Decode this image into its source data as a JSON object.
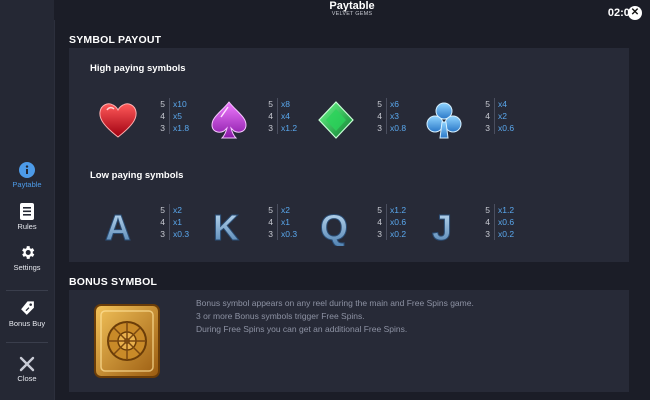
{
  "header": {
    "title": "Paytable",
    "subtitle": "VELVET GEMS",
    "clock": "02:00"
  },
  "sidebar": [
    {
      "label": "Paytable",
      "icon": "info-icon",
      "active": true
    },
    {
      "label": "Rules",
      "icon": "document-icon"
    },
    {
      "label": "Settings",
      "icon": "gear-icon"
    },
    {
      "label": "Bonus Buy",
      "icon": "tag-icon"
    },
    {
      "label": "Close",
      "icon": "close-icon"
    }
  ],
  "symbol_payout": {
    "title": "SYMBOL PAYOUT",
    "high_title": "High paying symbols",
    "high": [
      {
        "symbol": "heart-gem",
        "rows": [
          [
            "5",
            "x10"
          ],
          [
            "4",
            "x5"
          ],
          [
            "3",
            "x1.8"
          ]
        ]
      },
      {
        "symbol": "spade-gem",
        "rows": [
          [
            "5",
            "x8"
          ],
          [
            "4",
            "x4"
          ],
          [
            "3",
            "x1.2"
          ]
        ]
      },
      {
        "symbol": "diamond-gem",
        "rows": [
          [
            "5",
            "x6"
          ],
          [
            "4",
            "x3"
          ],
          [
            "3",
            "x0.8"
          ]
        ]
      },
      {
        "symbol": "club-gem",
        "rows": [
          [
            "5",
            "x4"
          ],
          [
            "4",
            "x2"
          ],
          [
            "3",
            "x0.6"
          ]
        ]
      }
    ],
    "low_title": "Low paying symbols",
    "low": [
      {
        "letter": "A",
        "rows": [
          [
            "5",
            "x2"
          ],
          [
            "4",
            "x1"
          ],
          [
            "3",
            "x0.3"
          ]
        ]
      },
      {
        "letter": "K",
        "rows": [
          [
            "5",
            "x2"
          ],
          [
            "4",
            "x1"
          ],
          [
            "3",
            "x0.3"
          ]
        ]
      },
      {
        "letter": "Q",
        "rows": [
          [
            "5",
            "x1.2"
          ],
          [
            "4",
            "x0.6"
          ],
          [
            "3",
            "x0.2"
          ]
        ]
      },
      {
        "letter": "J",
        "rows": [
          [
            "5",
            "x1.2"
          ],
          [
            "4",
            "x0.6"
          ],
          [
            "3",
            "x0.2"
          ]
        ]
      }
    ]
  },
  "bonus": {
    "title": "BONUS SYMBOL",
    "lines": [
      "Bonus symbol appears on any reel during the main and Free Spins game.",
      "3 or more Bonus symbols trigger Free Spins.",
      "During Free Spins you can get an additional Free Spins."
    ]
  },
  "colors": {
    "accent": "#4d9be8",
    "pay_value": "#5aa8ee",
    "panel": "#272a37",
    "background": "#1b1d27"
  }
}
